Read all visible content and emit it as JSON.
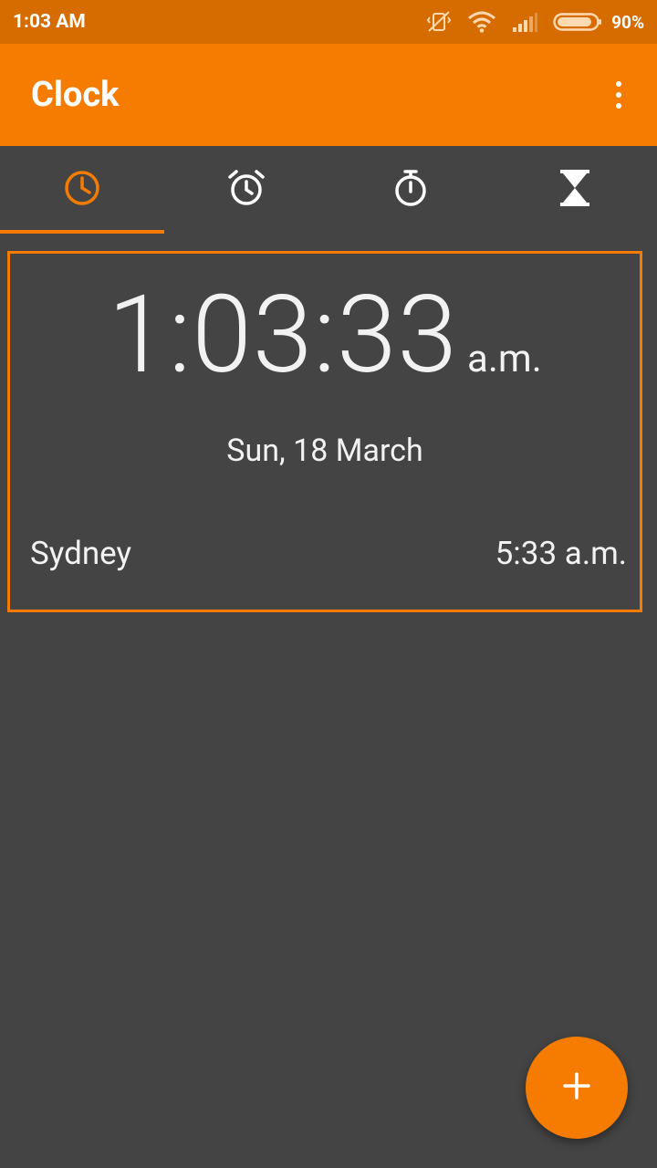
{
  "status_bar": {
    "time": "1:03 AM",
    "battery_percent": "90%",
    "icons": [
      "vibrate-off-icon",
      "wifi-icon",
      "signal-icon",
      "battery-icon"
    ],
    "battery_level": 0.9
  },
  "app_bar": {
    "title": "Clock",
    "overflow_icon": "more-vert-icon"
  },
  "tabs": [
    {
      "name": "clock",
      "icon": "clock-icon",
      "active": true
    },
    {
      "name": "alarm",
      "icon": "alarm-icon",
      "active": false
    },
    {
      "name": "stopwatch",
      "icon": "stopwatch-icon",
      "active": false
    },
    {
      "name": "timer",
      "icon": "hourglass-icon",
      "active": false
    }
  ],
  "clock": {
    "time": "1:03:33",
    "ampm": "a.m.",
    "date": "Sun, 18 March",
    "world_clocks": [
      {
        "city": "Sydney",
        "time": "5:33 a.m."
      }
    ]
  },
  "fab": {
    "icon": "add-icon"
  },
  "colors": {
    "accent": "#f57c00",
    "status_bar": "#d66c00",
    "background": "#444444",
    "inactive_icon": "#ffffff"
  }
}
